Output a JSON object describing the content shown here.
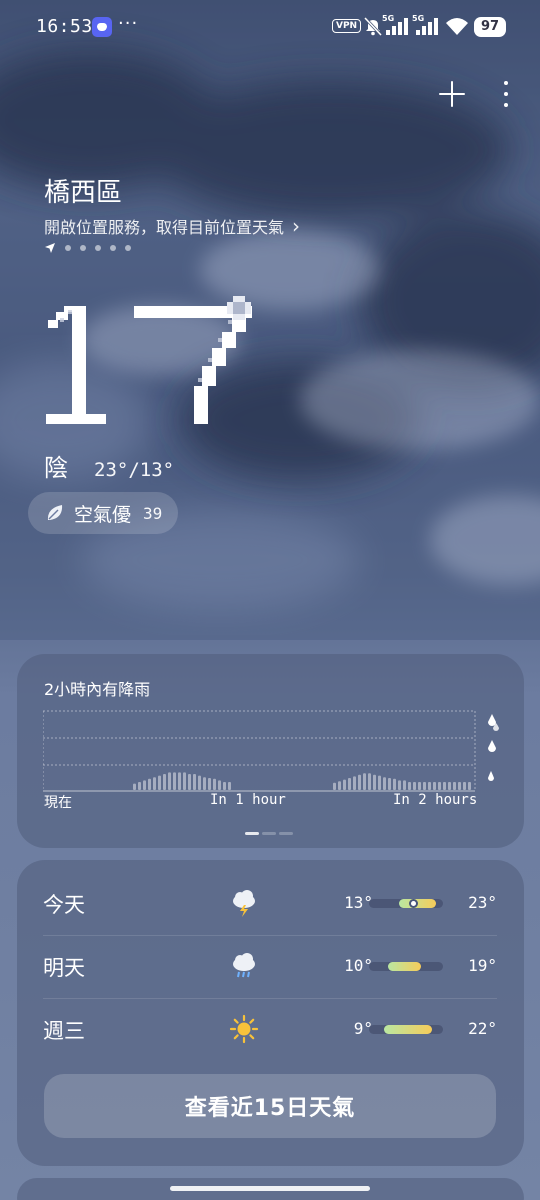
{
  "status_bar": {
    "time": "16:53",
    "more": "···",
    "vpn": "VPN",
    "signal_1_label": "5G",
    "signal_2_label": "5G",
    "battery": "97",
    "icons": [
      "discord-icon",
      "mute-icon",
      "signal-icon",
      "wifi-icon",
      "battery-icon"
    ]
  },
  "header": {
    "add_icon": "plus-icon",
    "menu_icon": "more-vertical-icon"
  },
  "location": {
    "city": "橋西區",
    "location_prompt": "開啟位置服務，取得目前位置天氣",
    "chevron": "›",
    "page_count": 6,
    "active_page": 0
  },
  "current": {
    "temperature": "17",
    "unit": "°",
    "condition": "陰",
    "range": "23°/13°",
    "air_quality_label": "空氣優",
    "air_quality_value": "39",
    "air_icon": "leaf-icon"
  },
  "precipitation": {
    "title": "2小時內有降雨",
    "axis_labels": [
      "現在",
      "In 1 hour",
      "In 2 hours"
    ],
    "intensity_icons": [
      "heavy-rain-icon",
      "moderate-rain-icon",
      "light-rain-icon"
    ],
    "intensity": [
      0.08,
      0.1,
      0.12,
      0.14,
      0.16,
      0.18,
      0.2,
      0.22,
      0.22,
      0.22,
      0.22,
      0.2,
      0.2,
      0.18,
      0.16,
      0.15,
      0.14,
      0.12,
      0.1,
      0.1,
      0,
      0,
      0,
      0,
      0,
      0,
      0,
      0,
      0,
      0,
      0,
      0,
      0,
      0,
      0,
      0,
      0,
      0,
      0,
      0,
      0.09,
      0.11,
      0.13,
      0.15,
      0.17,
      0.19,
      0.21,
      0.21,
      0.19,
      0.18,
      0.16,
      0.15,
      0.14,
      0.12,
      0.12,
      0.1,
      0.1,
      0.1,
      0.1,
      0.1,
      0.1,
      0.1,
      0.1,
      0.1,
      0.1,
      0.1,
      0.1,
      0.1
    ],
    "pager_count": 3,
    "pager_active": 0
  },
  "forecast": {
    "scale_min": 5,
    "scale_max": 25,
    "days": [
      {
        "day": "今天",
        "icon": "thunderstorm-icon",
        "low": "13°",
        "high": "23°",
        "low_value": 13,
        "high_value": 23,
        "current_value": 17
      },
      {
        "day": "明天",
        "icon": "rain-cloud-icon",
        "low": "10°",
        "high": "19°",
        "low_value": 10,
        "high_value": 19
      },
      {
        "day": "週三",
        "icon": "sunny-icon",
        "low": "9°",
        "high": "22°",
        "low_value": 9,
        "high_value": 22
      }
    ],
    "button_label": "查看近15日天氣"
  },
  "colors": {
    "bar_warm": "#f6cc5a",
    "bar_cool": "#b9e7a2",
    "sun": "#f8c23a"
  }
}
